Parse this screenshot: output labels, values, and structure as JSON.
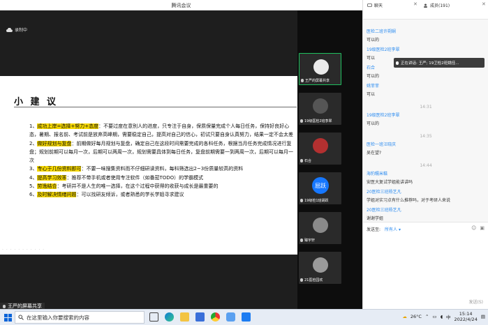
{
  "window": {
    "title": "腾讯会议"
  },
  "recording": {
    "label": "录制中"
  },
  "slide": {
    "title": "小 建 议",
    "items": [
      {
        "num": "1、",
        "highlight": "成功上岸=选择+努力+态度",
        "rest": "：不要过度在意别人的进度，只专注于自身，保质保量完成个人每日任务，保持好良好心态，暑期、报名前、考试前是放弃高峰期，需要稳定自己，提高对自己的信心，初试只要自身认真努力，结果一定不会太差"
      },
      {
        "num": "2、",
        "highlight": "做好规划与复盘",
        "rest": "：前期做好每月规划与复盘，确定自己在这段时间需要完成的各科任务，根据当月任务完成情况进行复盘；规划前期可以每月一次，后期可以两周一次，规划需要具体到每日任务，复盘前期需要一到两周一次，后期可以每月一次"
      },
      {
        "num": "3、",
        "highlight": "专心于几份资料即可",
        "rest": "：不要一味搜集资料而不仔细研读资料，每科筛选出2~3份质量较高的资料"
      },
      {
        "num": "4、",
        "highlight": "提高学习效率",
        "rest": "：推荐不带手机或者使用专注软件（如番茄TODO）的学霸模式"
      },
      {
        "num": "5、",
        "highlight": "劳逸结合",
        "rest": "：考研并不是人生的唯一选择，在这个过程中获得的收获与成长是最重要的"
      },
      {
        "num": "6、",
        "highlight": "及时解决情绪问题",
        "rest": "：可以找研友倾诉，或者熟悉的学长学姐寻求建议"
      }
    ]
  },
  "sharer_bar": {
    "label": "王严的屏幕共享"
  },
  "participants": [
    {
      "name": "王严的屏幕共享",
      "active": true,
      "avatar_color": "#eaeaea"
    },
    {
      "name": "19级医检2班李翠",
      "active": false,
      "avatar_color": "#555555"
    },
    {
      "name": "石合",
      "active": false,
      "avatar_color": "#b33030"
    },
    {
      "name": "19级检1班胡跃",
      "active": false,
      "badge": "屈跃"
    },
    {
      "name": "臻宇轩",
      "active": false,
      "avatar_color": "#8a8a8a"
    },
    {
      "name": "21医检园欢",
      "active": false,
      "avatar_color": "#9a9a9a"
    }
  ],
  "panel": {
    "chat_tab": "聊天",
    "members_tab": "成员(191)",
    "messages": [
      {
        "kind": "sender",
        "text": "医检二班许朔娴"
      },
      {
        "kind": "text",
        "text": "可以的"
      },
      {
        "kind": "sender",
        "text": "19级医检2班李翠"
      },
      {
        "kind": "text",
        "text": "可以"
      },
      {
        "kind": "sender",
        "text": "石合"
      },
      {
        "kind": "text",
        "text": "可以的"
      },
      {
        "kind": "sender",
        "text": "姚菲菲"
      },
      {
        "kind": "text",
        "text": "可以"
      },
      {
        "kind": "time",
        "text": "14:31"
      },
      {
        "kind": "sender",
        "text": "19级医检2班李翠"
      },
      {
        "kind": "text",
        "text": "可以的"
      },
      {
        "kind": "time",
        "text": "14:35"
      },
      {
        "kind": "sender",
        "text": "医检一班汪晓庆"
      },
      {
        "kind": "text",
        "text": "吴在望?"
      },
      {
        "kind": "time",
        "text": "14:44"
      },
      {
        "kind": "sender",
        "text": "海豹糯米糍"
      },
      {
        "kind": "text",
        "text": "安医大复试学姐能讲讲吗"
      },
      {
        "kind": "sender",
        "text": "20医检三班杨艺凡"
      },
      {
        "kind": "text",
        "text": "学姐对实习点有什么推荐吗，对于考研人来说"
      },
      {
        "kind": "sender",
        "text": "20医检三班杨艺凡"
      },
      {
        "kind": "text",
        "text": "谢谢学姐"
      }
    ],
    "speaking_label": "正在讲话: 王严; 19卫检2班姚佳...",
    "send_to_label": "发送至:",
    "send_to_value": "所有人",
    "send_button": "发送(S)"
  },
  "taskbar": {
    "search_placeholder": "在这里输入你要搜索的内容",
    "weather": "26°C",
    "ime": "中",
    "time": "15:14",
    "date": "2022/4/24"
  }
}
